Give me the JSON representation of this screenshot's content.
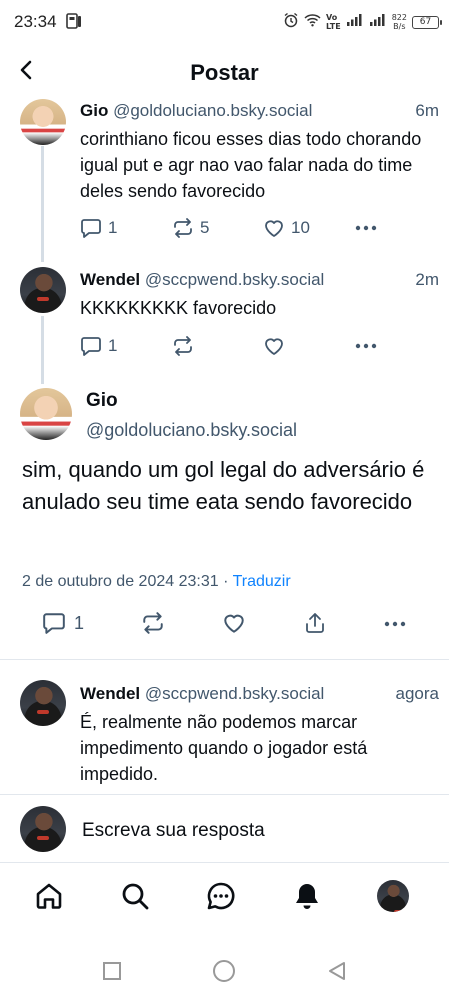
{
  "status_bar": {
    "time": "23:34",
    "speed_value": "822",
    "speed_unit": "B/s",
    "volte_top": "Vo",
    "volte_bottom": "LTE",
    "battery": "67"
  },
  "header": {
    "title": "Postar"
  },
  "thread": [
    {
      "name": "Gio",
      "handle": "@goldoluciano.bsky.social",
      "age": "6m",
      "text": "corinthiano ficou esses dias todo chorando igual put e agr nao vao falar nada do time deles sendo favorecido",
      "replies": "1",
      "reposts": "5",
      "likes": "10"
    },
    {
      "name": "Wendel",
      "handle": "@sccpwend.bsky.social",
      "age": "2m",
      "text": "KKKKKKKKK favorecido",
      "replies": "1"
    }
  ],
  "main_post": {
    "name": "Gio",
    "handle": "@goldoluciano.bsky.social",
    "text": "sim, quando um gol legal do adversário é anulado seu time eata sendo favorecido",
    "date": "2 de outubro de 2024 23:31",
    "separator": " · ",
    "translate": "Traduzir",
    "replies": "1"
  },
  "reply": {
    "name": "Wendel",
    "handle": "@sccpwend.bsky.social",
    "age": "agora",
    "text": "É, realmente não podemos marcar impedimento quando o jogador está impedido."
  },
  "composer": {
    "placeholder": "Escreva sua resposta"
  },
  "tabs": [
    "home-icon",
    "search-icon",
    "chat-icon",
    "notifications-icon",
    "profile-avatar"
  ],
  "colors": {
    "text": "#0b0f14",
    "muted": "#42576c",
    "link": "#1083fe",
    "divider": "#e2e7ed"
  }
}
